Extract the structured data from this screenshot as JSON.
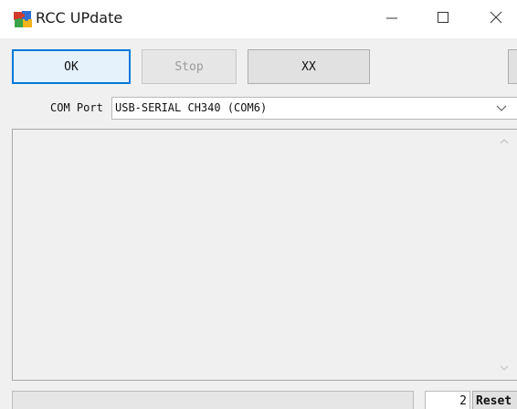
{
  "window": {
    "title": "RCC UPdate",
    "icon": "puzzle-icon"
  },
  "title_controls": {
    "minimize_icon": "minimize-icon",
    "maximize_icon": "maximize-icon",
    "close_icon": "close-icon"
  },
  "toolbar": {
    "ok_label": "OK",
    "stop_label": "Stop",
    "xx_label": "XX",
    "extra_label": ""
  },
  "com_port": {
    "label": "COM Port",
    "selected_value": "USB-SERIAL CH340 (COM6)"
  },
  "log": {
    "text": ""
  },
  "status": {
    "count_value": "2",
    "reset_label": "Reset"
  },
  "colors": {
    "accent": "#0078d7",
    "window_bg": "#f0f0f0",
    "titlebar_bg": "#ffffff"
  }
}
